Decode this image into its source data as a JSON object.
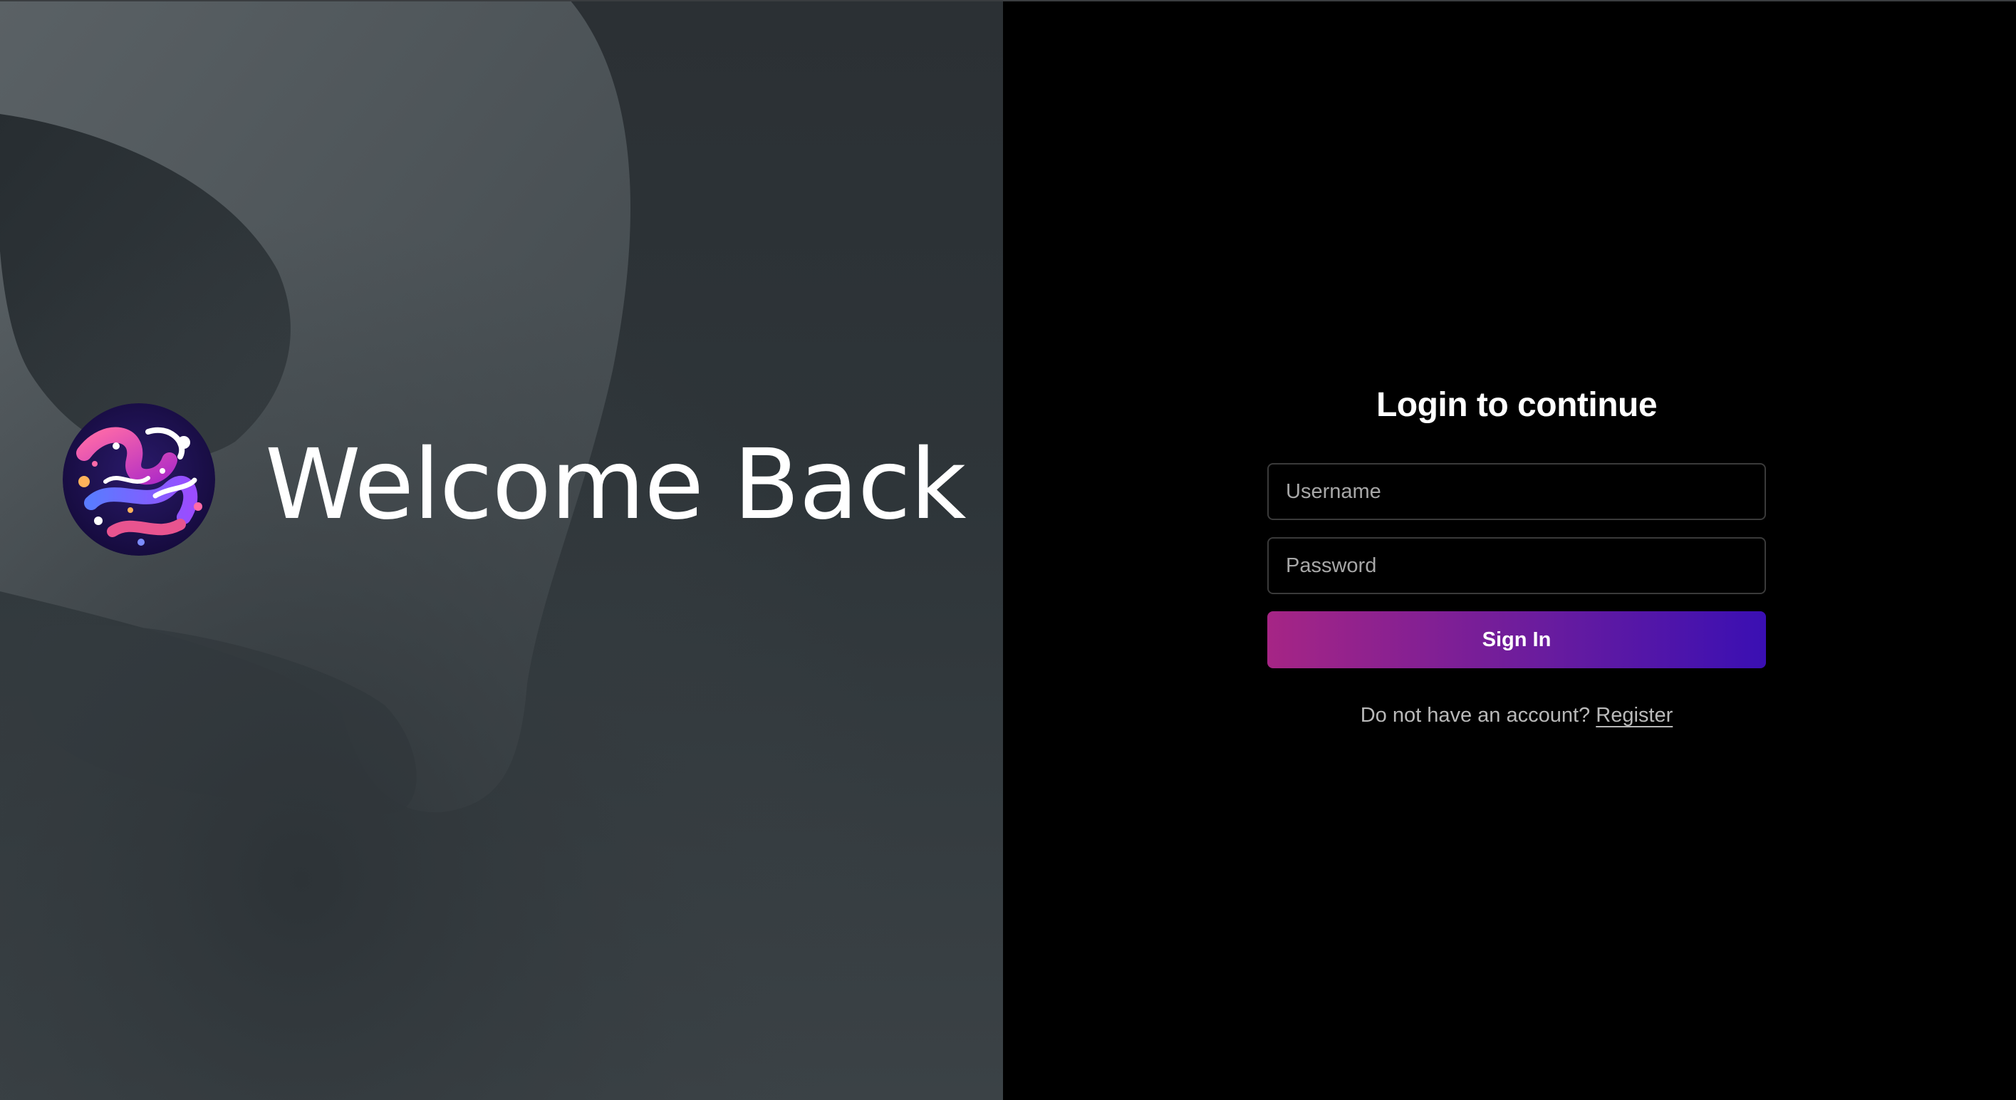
{
  "hero": {
    "title": "Welcome Back",
    "logo_icon": "abstract-swirl-logo"
  },
  "login": {
    "title": "Login to continue",
    "username_placeholder": "Username",
    "password_placeholder": "Password",
    "signin_label": "Sign In",
    "register_prompt": "Do not have an account?",
    "register_link": "Register"
  },
  "colors": {
    "button_gradient_start": "#a62585",
    "button_gradient_end": "#3a0fb3",
    "panel_background": "#000000",
    "hero_background": "#2e3539"
  }
}
